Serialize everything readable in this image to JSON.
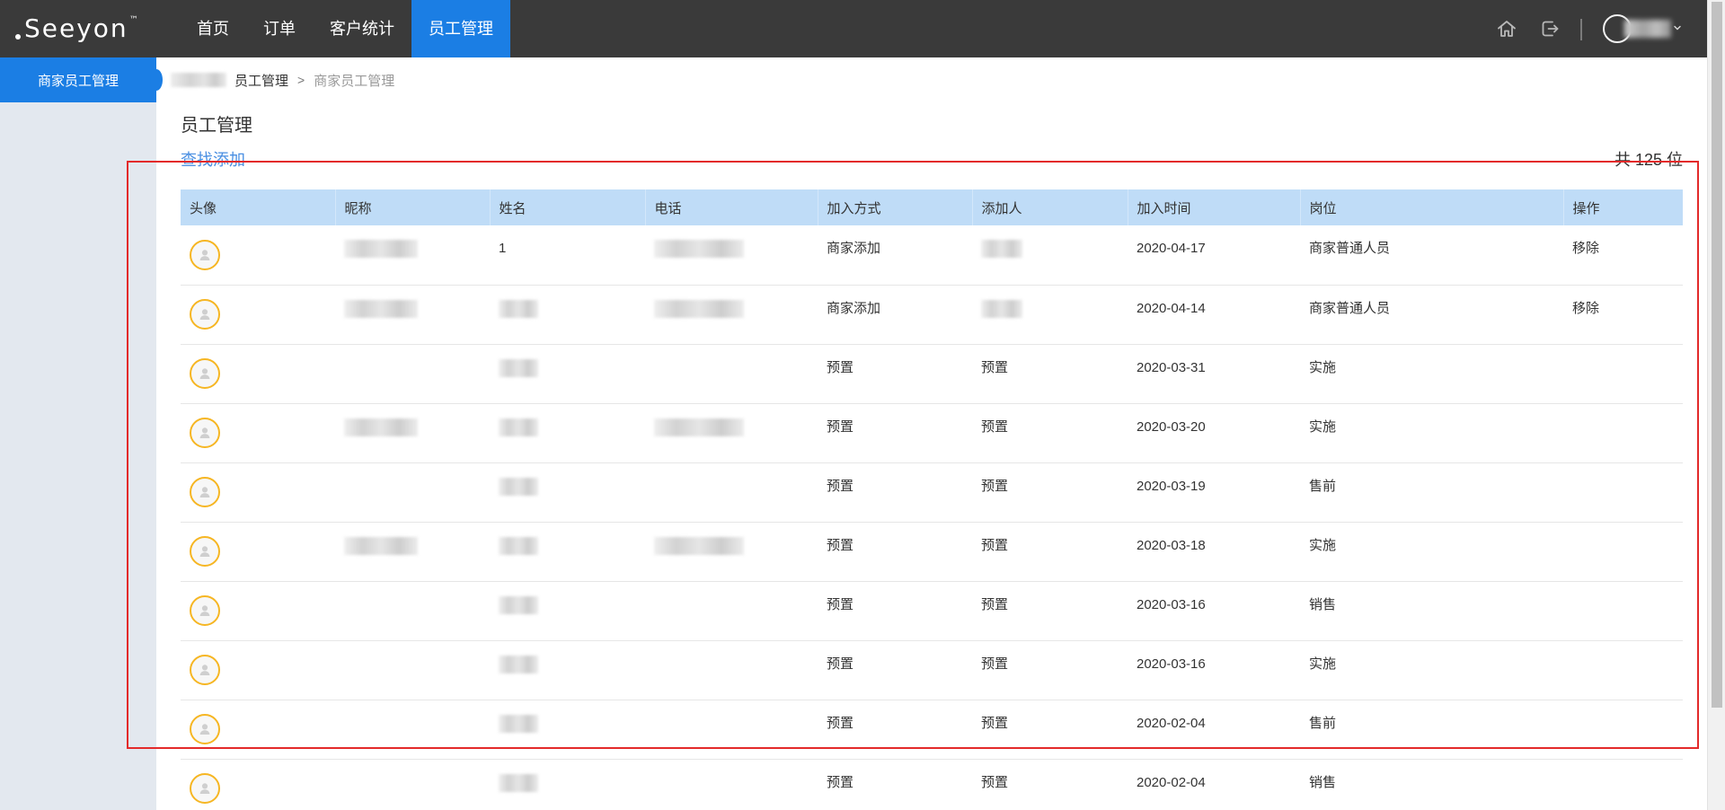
{
  "header": {
    "logo": {
      "text": "Seeyon",
      "mark": "™"
    },
    "nav": [
      {
        "label": "首页",
        "active": false
      },
      {
        "label": "订单",
        "active": false
      },
      {
        "label": "客户统计",
        "active": false
      },
      {
        "label": "员工管理",
        "active": true
      }
    ],
    "icons": {
      "home": "home-icon",
      "logout": "logout-icon",
      "user_menu_caret": "chevron-down-icon"
    },
    "user": {
      "avatar": "user-avatar-icon",
      "name": {
        "redacted": true
      }
    }
  },
  "sidebar": {
    "items": [
      {
        "label": "商家员工管理",
        "active": true
      }
    ]
  },
  "breadcrumb": {
    "items": [
      {
        "redacted": true
      },
      {
        "label": "员工管理"
      },
      {
        "label": "商家员工管理"
      }
    ],
    "separator": ">"
  },
  "page": {
    "title": "员工管理",
    "search_add_link": "查找添加",
    "total": "共 125 位"
  },
  "table": {
    "avatar_icon": "default-user-avatar-icon",
    "columns": [
      "头像",
      "昵称",
      "姓名",
      "电话",
      "加入方式",
      "添加人",
      "加入时间",
      "岗位",
      "操作"
    ],
    "rows": [
      {
        "nickname": {
          "redacted": true
        },
        "name": "1",
        "phone": {
          "redacted": true
        },
        "join_method": "商家添加",
        "added_by": {
          "redacted": true
        },
        "join_date": "2020-04-17",
        "position": "商家普通人员",
        "action": "移除"
      },
      {
        "nickname": {
          "redacted": true
        },
        "name": {
          "redacted": true
        },
        "phone": {
          "redacted": true
        },
        "join_method": "商家添加",
        "added_by": {
          "redacted": true
        },
        "join_date": "2020-04-14",
        "position": "商家普通人员",
        "action": "移除"
      },
      {
        "name": {
          "redacted": true
        },
        "join_method": "预置",
        "added_by": "预置",
        "join_date": "2020-03-31",
        "position": "实施"
      },
      {
        "nickname": {
          "redacted": true
        },
        "name": {
          "redacted": true
        },
        "phone": {
          "redacted": true
        },
        "join_method": "预置",
        "added_by": "预置",
        "join_date": "2020-03-20",
        "position": "实施"
      },
      {
        "name": {
          "redacted": true
        },
        "join_method": "预置",
        "added_by": "预置",
        "join_date": "2020-03-19",
        "position": "售前"
      },
      {
        "nickname": {
          "redacted": true
        },
        "name": {
          "redacted": true
        },
        "phone": {
          "redacted": true
        },
        "join_method": "预置",
        "added_by": "预置",
        "join_date": "2020-03-18",
        "position": "实施"
      },
      {
        "name": {
          "redacted": true
        },
        "join_method": "预置",
        "added_by": "预置",
        "join_date": "2020-03-16",
        "position": "销售"
      },
      {
        "name": {
          "redacted": true
        },
        "join_method": "预置",
        "added_by": "预置",
        "join_date": "2020-03-16",
        "position": "实施"
      },
      {
        "name": {
          "redacted": true
        },
        "join_method": "预置",
        "added_by": "预置",
        "join_date": "2020-02-04",
        "position": "售前"
      },
      {
        "name": {
          "redacted": true
        },
        "join_method": "预置",
        "added_by": "预置",
        "join_date": "2020-02-04",
        "position": "销售"
      }
    ]
  },
  "colors": {
    "accent": "#1b7ee4",
    "header_bg": "#3a3a3a",
    "sidebar_bg": "#e3e8ef",
    "table_header_bg": "#bfdcf7",
    "link": "#4a8fe2",
    "avatar_ring": "#f6b623",
    "highlight": "#e32a2a"
  }
}
